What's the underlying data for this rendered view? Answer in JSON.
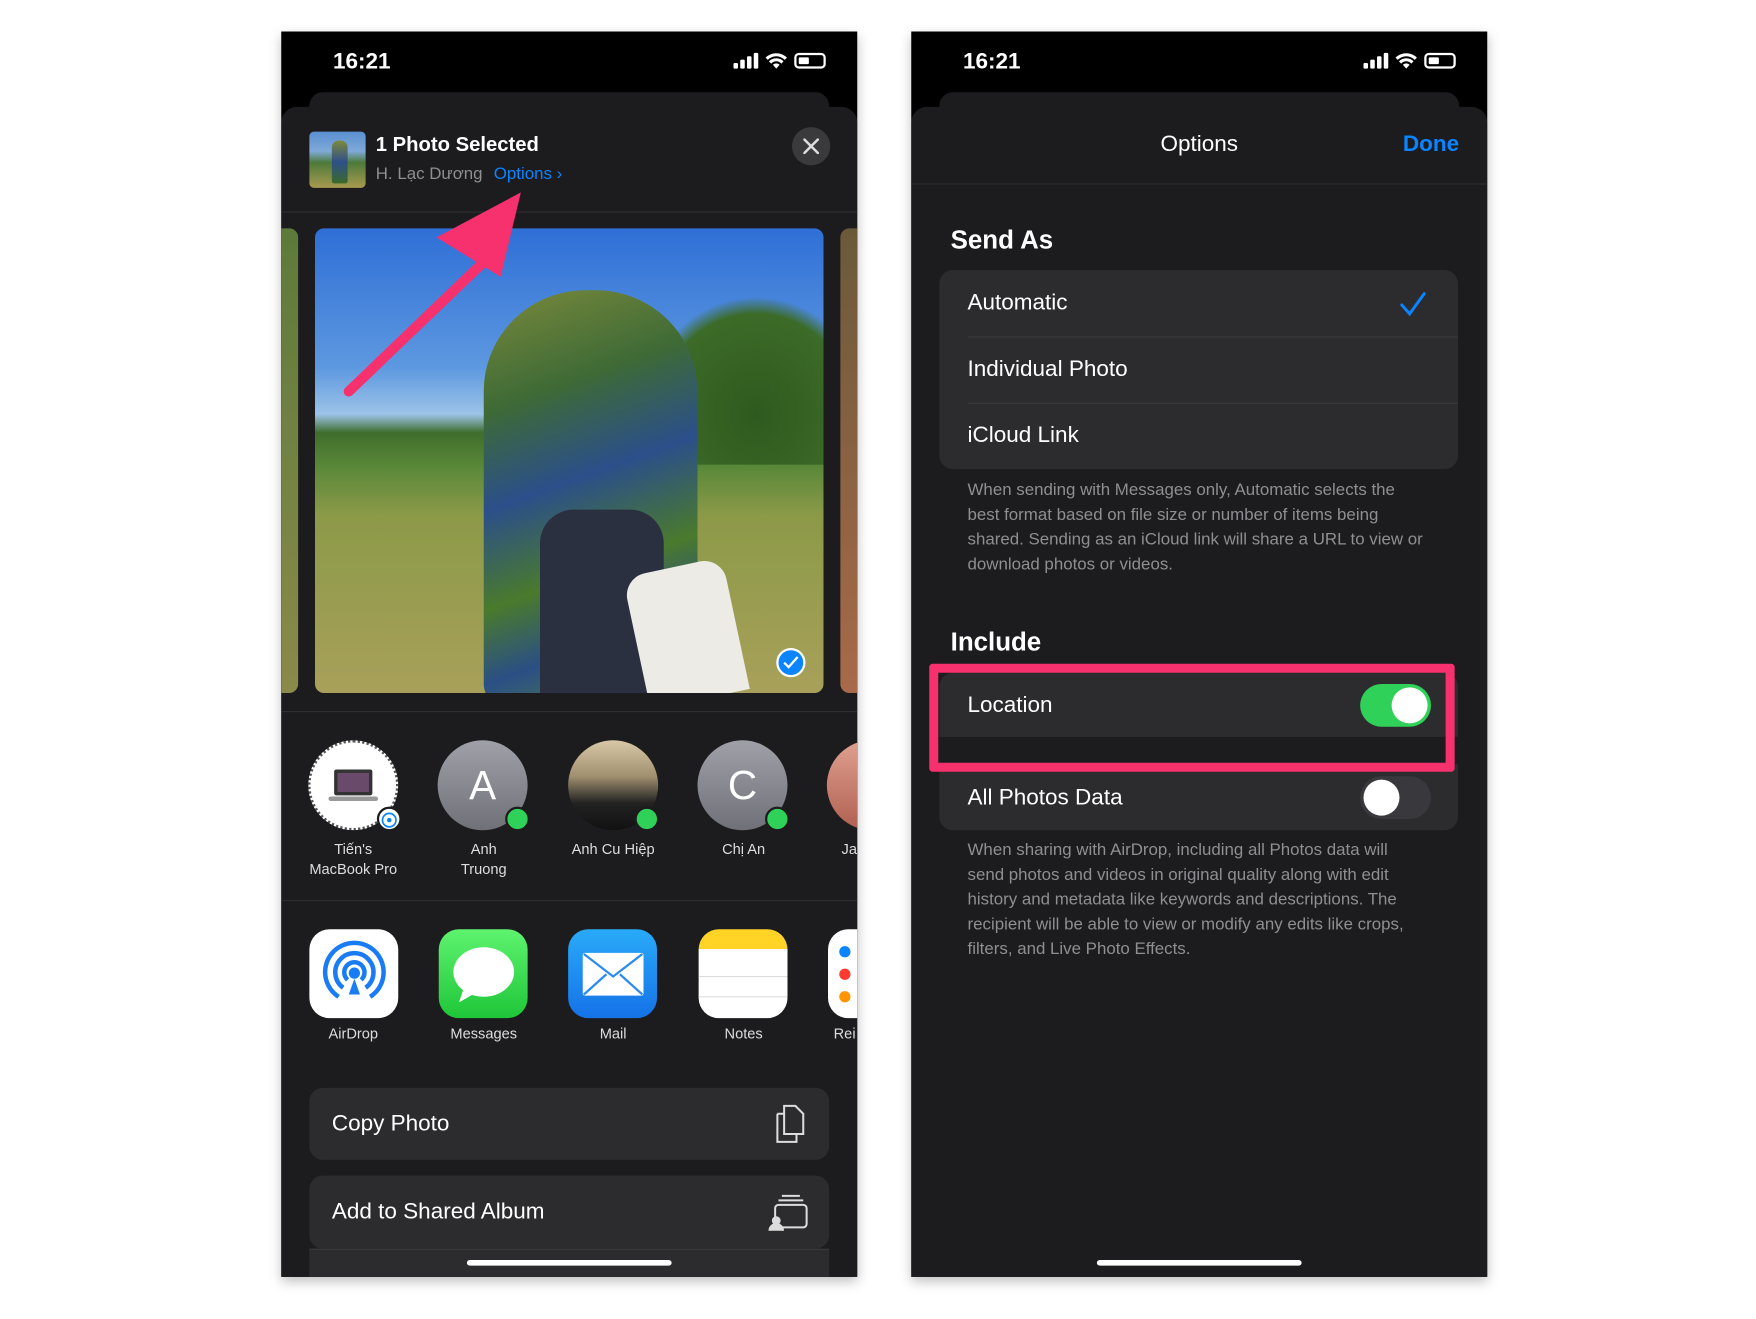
{
  "left": {
    "status_time": "16:21",
    "header": {
      "title": "1 Photo Selected",
      "location": "H. Lạc Dương",
      "options_link": "Options",
      "options_chevron": "›"
    },
    "people": [
      {
        "name": "Tiến's MacBook Pro",
        "line1": "Tiến's",
        "line2": "MacBook Pro",
        "type": "airdrop-device"
      },
      {
        "name": "Anh Truong",
        "line1": "Anh",
        "line2": "Truong",
        "initial": "A"
      },
      {
        "name": "Anh Cu Hiệp",
        "line1": "Anh Cu Hiệp",
        "line2": ""
      },
      {
        "name": "Chị An",
        "line1": "Chị An",
        "line2": "",
        "initial": "C"
      },
      {
        "name": "Ja",
        "line1": "Ja",
        "line2": ""
      }
    ],
    "apps": [
      {
        "label": "AirDrop",
        "icon": "airdrop-icon"
      },
      {
        "label": "Messages",
        "icon": "messages-icon"
      },
      {
        "label": "Mail",
        "icon": "mail-icon"
      },
      {
        "label": "Notes",
        "icon": "notes-icon"
      },
      {
        "label": "Rei",
        "icon": "reminders-icon"
      }
    ],
    "actions": [
      {
        "label": "Copy Photo",
        "icon": "copy-icon"
      },
      {
        "label": "Add to Shared Album",
        "icon": "shared-album-icon"
      }
    ]
  },
  "right": {
    "status_time": "16:21",
    "title": "Options",
    "done": "Done",
    "send_as": {
      "heading": "Send As",
      "options": [
        "Automatic",
        "Individual Photo",
        "iCloud Link"
      ],
      "selected": "Automatic",
      "footnote": "When sending with Messages only, Automatic selects the best format based on file size or number of items being shared. Sending as an iCloud link will share a URL to view or download photos or videos."
    },
    "include": {
      "heading": "Include",
      "location": {
        "label": "Location",
        "on": true
      },
      "all_photos_data": {
        "label": "All Photos Data",
        "on": false
      },
      "footnote": "When sharing with AirDrop, including all Photos data will send photos and videos in original quality along with edit history and metadata like keywords and descriptions. The recipient will be able to view or modify any edits like crops, filters, and Live Photo Effects."
    }
  },
  "colors": {
    "accent": "#0a84ff",
    "annotation": "#f7306e",
    "toggle_on": "#30d158",
    "sheet": "#1c1c1e"
  }
}
